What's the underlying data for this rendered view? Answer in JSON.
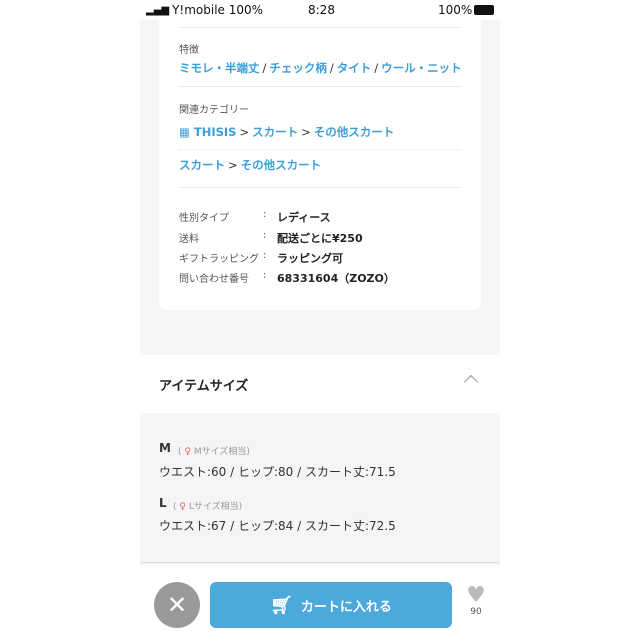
{
  "status": {
    "carrier": "Y!mobile 100%",
    "time": "8:28",
    "battery": "100%"
  },
  "features": {
    "label": "特徴",
    "items": [
      "ミモレ・半端丈",
      "チェック柄",
      "タイト",
      "ウール・ニット"
    ]
  },
  "related": {
    "label": "関連カテゴリー",
    "brand": "THISIS",
    "path1": [
      "スカート",
      "その他スカート"
    ],
    "path2": [
      "スカート",
      "その他スカート"
    ]
  },
  "specs": [
    {
      "k": "性別タイプ",
      "v": "レディース"
    },
    {
      "k": "送料",
      "v": "配送ごとに¥250"
    },
    {
      "k": "ギフトラッピング",
      "v": "ラッピング可"
    },
    {
      "k": "問い合わせ番号",
      "v": "68331604（ZOZO）"
    }
  ],
  "size_section": {
    "title": "アイテムサイズ",
    "sizes": [
      {
        "name": "M",
        "note": "Mサイズ相当",
        "dims": "ウエスト:60 / ヒップ:80 / スカート丈:71.5"
      },
      {
        "name": "L",
        "note": "Lサイズ相当",
        "dims": "ウエスト:67 / ヒップ:84 / スカート丈:72.5"
      }
    ]
  },
  "footer": {
    "cart_label": "カートに入れる",
    "likes": "90"
  },
  "colors": {
    "accent": "#3a9fd8",
    "cart": "#4da8dc"
  }
}
